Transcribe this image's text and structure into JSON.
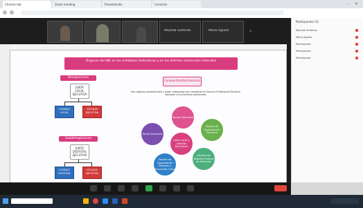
{
  "browser": {
    "tabs": [
      {
        "label": "Chrome tab"
      },
      {
        "label": "Zoom meeting"
      },
      {
        "label": "Presentación"
      },
      {
        "label": "Comisión"
      }
    ]
  },
  "meeting": {
    "participants_video": [
      {
        "name": ""
      },
      {
        "name": ""
      },
      {
        "name": ""
      },
      {
        "name": "Meyhak Soliteras"
      },
      {
        "name": "Mario Aguilar"
      }
    ]
  },
  "slide": {
    "title": "Órganos del INE en las entidades federativas y en los distritos electorales federales",
    "left_top_header": "Delegaciones",
    "left_top_middle": "JUNTA LOCAL EJECUTIVA",
    "left_top_blue": "CONSEJO LOCAL",
    "left_top_red": "VOCALÍA EJECUTIVA",
    "left_bottom_header": "Subdelegaciones",
    "left_bottom_middle": "JUNTA DISTRITAL EJECUTIVA",
    "left_bottom_blue": "CONSEJO DISTRITAL",
    "left_bottom_red": "VOCALÍA EJECUTIVA",
    "right_header": "Consejo Distrital Electoral",
    "right_caption": "Son órganos permanentes y están integrados por miembros de Servicio Profesional Electoral Nacional y funcionarios electorales",
    "center_circle": "Junta Local y Distrital Ejecutivas",
    "circles": [
      "Vocalía Ejecutiva",
      "Vocalía de Organización Electoral",
      "Vocalía del Registro Federal de Electores",
      "Vocalía de Capacitación Electoral y Educación Cívica",
      "Vocal Secretario"
    ]
  },
  "participants_panel": {
    "title": "Participantes (5)",
    "items": [
      "Meyhak Soliteras",
      "Mario Aguilar",
      "Participante",
      "Participante",
      "Participante"
    ]
  },
  "colors": {
    "pink": "#d93b7f",
    "blue": "#2f6fbf",
    "red": "#d23b3b"
  }
}
